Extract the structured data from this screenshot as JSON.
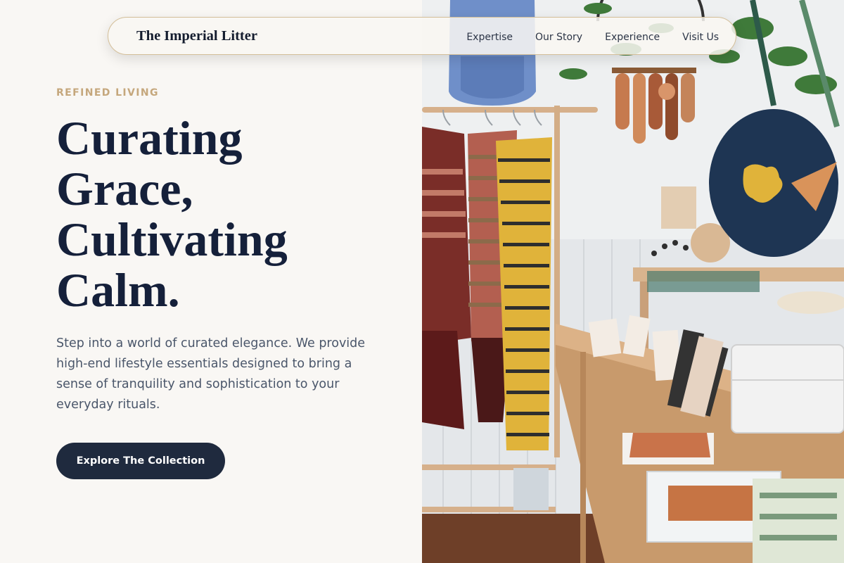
{
  "nav": {
    "brand": "The Imperial Litter",
    "links": [
      "Expertise",
      "Our Story",
      "Experience",
      "Visit Us"
    ]
  },
  "hero": {
    "eyebrow": "REFINED LIVING",
    "headline": [
      "Curating",
      "Grace,",
      "Cultivating",
      "Calm."
    ],
    "body": "Step into a world of curated elegance. We provide high-end lifestyle essentials designed to bring a sense of tranquility and sophistication to your everyday rituals.",
    "cta_label": "Explore The Collection"
  },
  "colors": {
    "page_background": "#f9f7f4",
    "accent_gold": "#c5a77c",
    "headline_navy": "#15203a",
    "button_navy": "#1f2a3e",
    "body_text": "#4a566a"
  }
}
